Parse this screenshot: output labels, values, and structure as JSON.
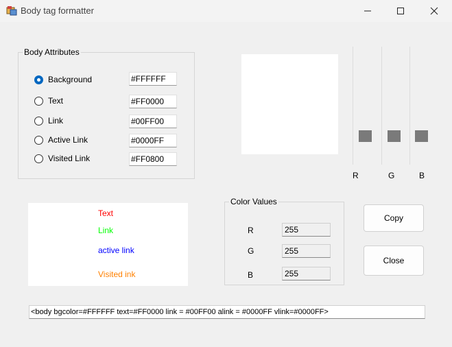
{
  "window": {
    "title": "Body tag formatter"
  },
  "body_attributes": {
    "legend": "Body Attributes",
    "items": [
      {
        "label": "Background",
        "value": "#FFFFFF",
        "selected": true
      },
      {
        "label": "Text",
        "value": "#FF0000",
        "selected": false
      },
      {
        "label": "Link",
        "value": "#00FF00",
        "selected": false
      },
      {
        "label": "Active Link",
        "value": "#0000FF",
        "selected": false
      },
      {
        "label": "Visited Link",
        "value": "#FF0800",
        "selected": false
      }
    ]
  },
  "sliders": {
    "r_label": "R",
    "g_label": "G",
    "b_label": "B"
  },
  "sample": {
    "text": "Text",
    "link": "Link",
    "active_link": "active link",
    "visited_link": "Visited ink",
    "colors": {
      "text": "#FF0000",
      "link": "#00FF00",
      "active_link": "#0000FF",
      "visited_link": "#FF8000"
    }
  },
  "color_values": {
    "legend": "Color Values",
    "r_label": "R",
    "r_value": "255",
    "g_label": "G",
    "g_value": "255",
    "b_label": "B",
    "b_value": "255"
  },
  "buttons": {
    "copy": "Copy",
    "close": "Close"
  },
  "output": {
    "tag": "<body bgcolor=#FFFFFF text=#FF0000 link = #00FF00 alink = #0000FF vlink=#0000FF>"
  },
  "preview_color": "#FFFFFF"
}
